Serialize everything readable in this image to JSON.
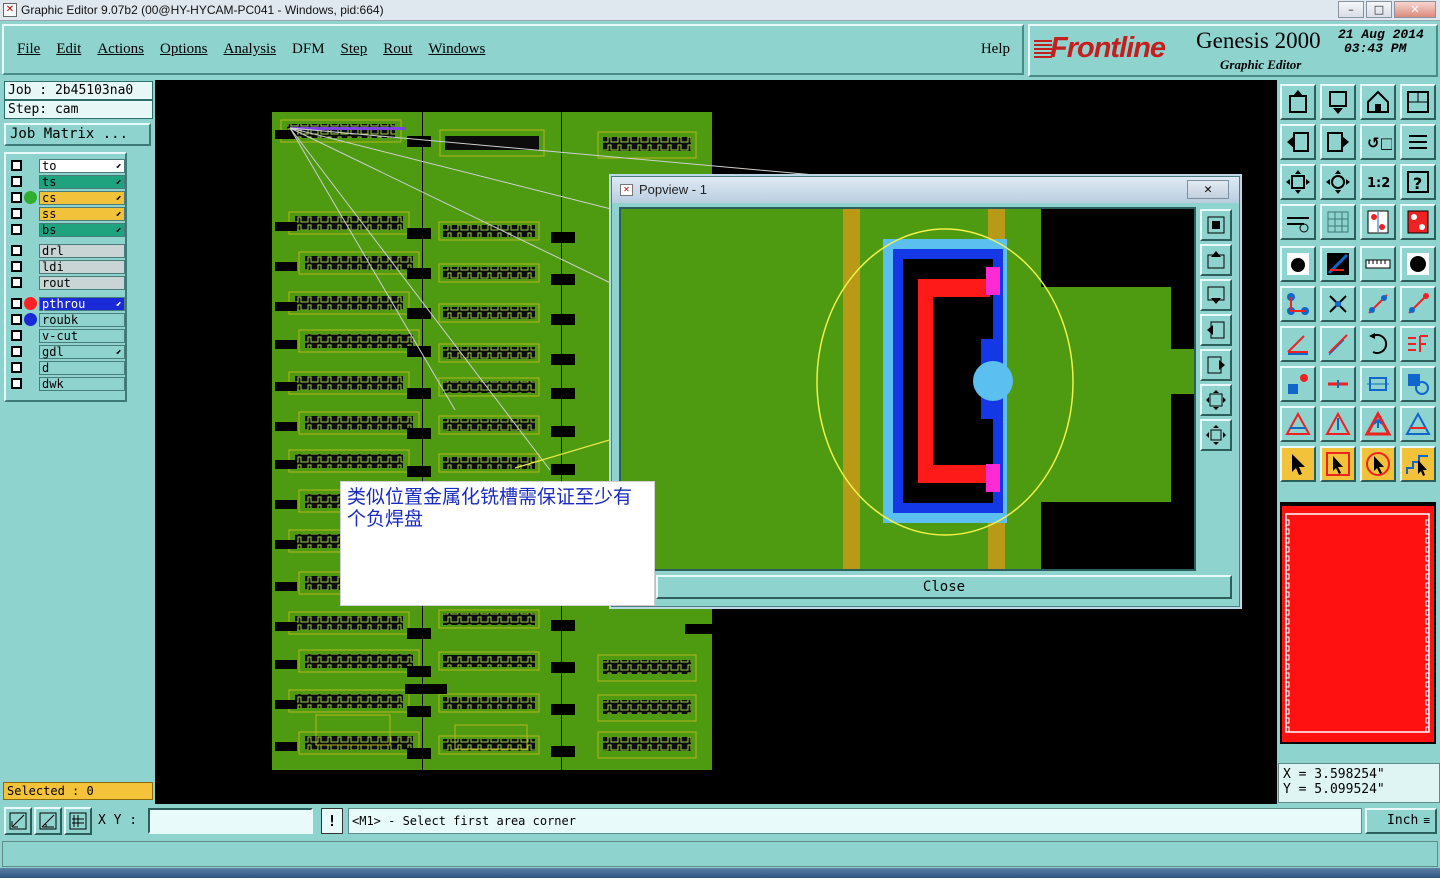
{
  "window": {
    "title": "Graphic Editor 9.07b2 (00@HY-HYCAM-PC041 - Windows, pid:664)",
    "minimize": "–",
    "maximize": "□",
    "close": "✕"
  },
  "menu": {
    "items": [
      {
        "label": "File"
      },
      {
        "label": "Edit"
      },
      {
        "label": "Actions"
      },
      {
        "label": "Options"
      },
      {
        "label": "Analysis"
      },
      {
        "label": "DFM"
      },
      {
        "label": "Step"
      },
      {
        "label": "Rout"
      },
      {
        "label": "Windows"
      }
    ],
    "help": "Help"
  },
  "logo": {
    "brand": "Frontline",
    "product": "Genesis 2000",
    "subtitle": "Graphic Editor",
    "date": "21 Aug 2014",
    "time": "03:43 PM"
  },
  "job": {
    "job_label": "Job : 2b45103na0",
    "step_label": "Step: cam",
    "matrix_button": "Job Matrix ..."
  },
  "layers": [
    {
      "name": "to",
      "color": "#ffffff",
      "dot": "",
      "edit": true
    },
    {
      "name": "ts",
      "color": "#1fa37f",
      "dot": "",
      "edit": true
    },
    {
      "name": "cs",
      "color": "#f2c23b",
      "dot": "#2fae2f",
      "edit": true
    },
    {
      "name": "ss",
      "color": "#f2c23b",
      "dot": "",
      "edit": true
    },
    {
      "name": "bs",
      "color": "#1fa37f",
      "dot": "",
      "edit": true
    },
    {
      "name": "drl",
      "color": "#c9d4d4",
      "dot": "",
      "edit": false
    },
    {
      "name": "ldi",
      "color": "#c9d4d4",
      "dot": "",
      "edit": false
    },
    {
      "name": "rout",
      "color": "#c9d4d4",
      "dot": "",
      "edit": false
    },
    {
      "name": "pthrou",
      "color": "#1a2ad6",
      "dot": "#ff2222",
      "edit": true
    },
    {
      "name": "roubk",
      "color": "#8fd3cf",
      "dot": "#1a2ad6",
      "edit": false
    },
    {
      "name": "v-cut",
      "color": "#8fd3cf",
      "dot": "",
      "edit": false
    },
    {
      "name": "gdl",
      "color": "#8fd3cf",
      "dot": "",
      "edit": true
    },
    {
      "name": "d",
      "color": "#8fd3cf",
      "dot": "",
      "edit": false
    },
    {
      "name": "dwk",
      "color": "#8fd3cf",
      "dot": "",
      "edit": false
    }
  ],
  "selected": "Selected : 0",
  "popview": {
    "title": "Popview - 1",
    "close_x": "✕",
    "close_button": "Close"
  },
  "annotation": {
    "text": "类似位置金属化铣槽需保证至少有个负焊盘"
  },
  "coords": {
    "x": "X = 3.598254\"",
    "y": "Y = 5.099524\""
  },
  "bottom": {
    "xy_label": "X Y :",
    "xy_value": "",
    "excl": "!",
    "prompt": "<M1> - Select first area corner",
    "unit": "Inch"
  },
  "icons": {
    "toolbar_rows": [
      [
        "panel-up-icon",
        "panel-down-icon",
        "home-icon",
        "split-view-icon"
      ],
      [
        "arrow-left-icon",
        "arrow-right-icon",
        "rotate-icon",
        "scale-icon"
      ],
      [
        "fit-screen-icon",
        "zoom-all-icon",
        "ratio-1-2-icon",
        "help-icon"
      ],
      [
        "measure-tool-icon",
        "grid-icon",
        "layer-stack-icon",
        "layer-stack-red-icon"
      ],
      [
        "pad-select-icon",
        "line-draw-icon",
        "ruler-icon",
        "circle-dot-icon"
      ],
      [
        "node-connect-icon",
        "cross-delete-icon",
        "line-edit-icon",
        "arc-edit-icon"
      ],
      [
        "angle-icon",
        "slash-icon",
        "undo-arc-icon",
        "flip-icon"
      ],
      [
        "square-node-icon",
        "minus-icon",
        "dimension-icon",
        "group-icon"
      ],
      [
        "triangle-outline-icon",
        "triangle-up-icon",
        "triangle-arrow-icon",
        "triangle-arrows-icon"
      ],
      [
        "pointer-icon",
        "pointer-box-icon",
        "pointer-circle-icon",
        "pointer-steps-icon"
      ]
    ]
  }
}
